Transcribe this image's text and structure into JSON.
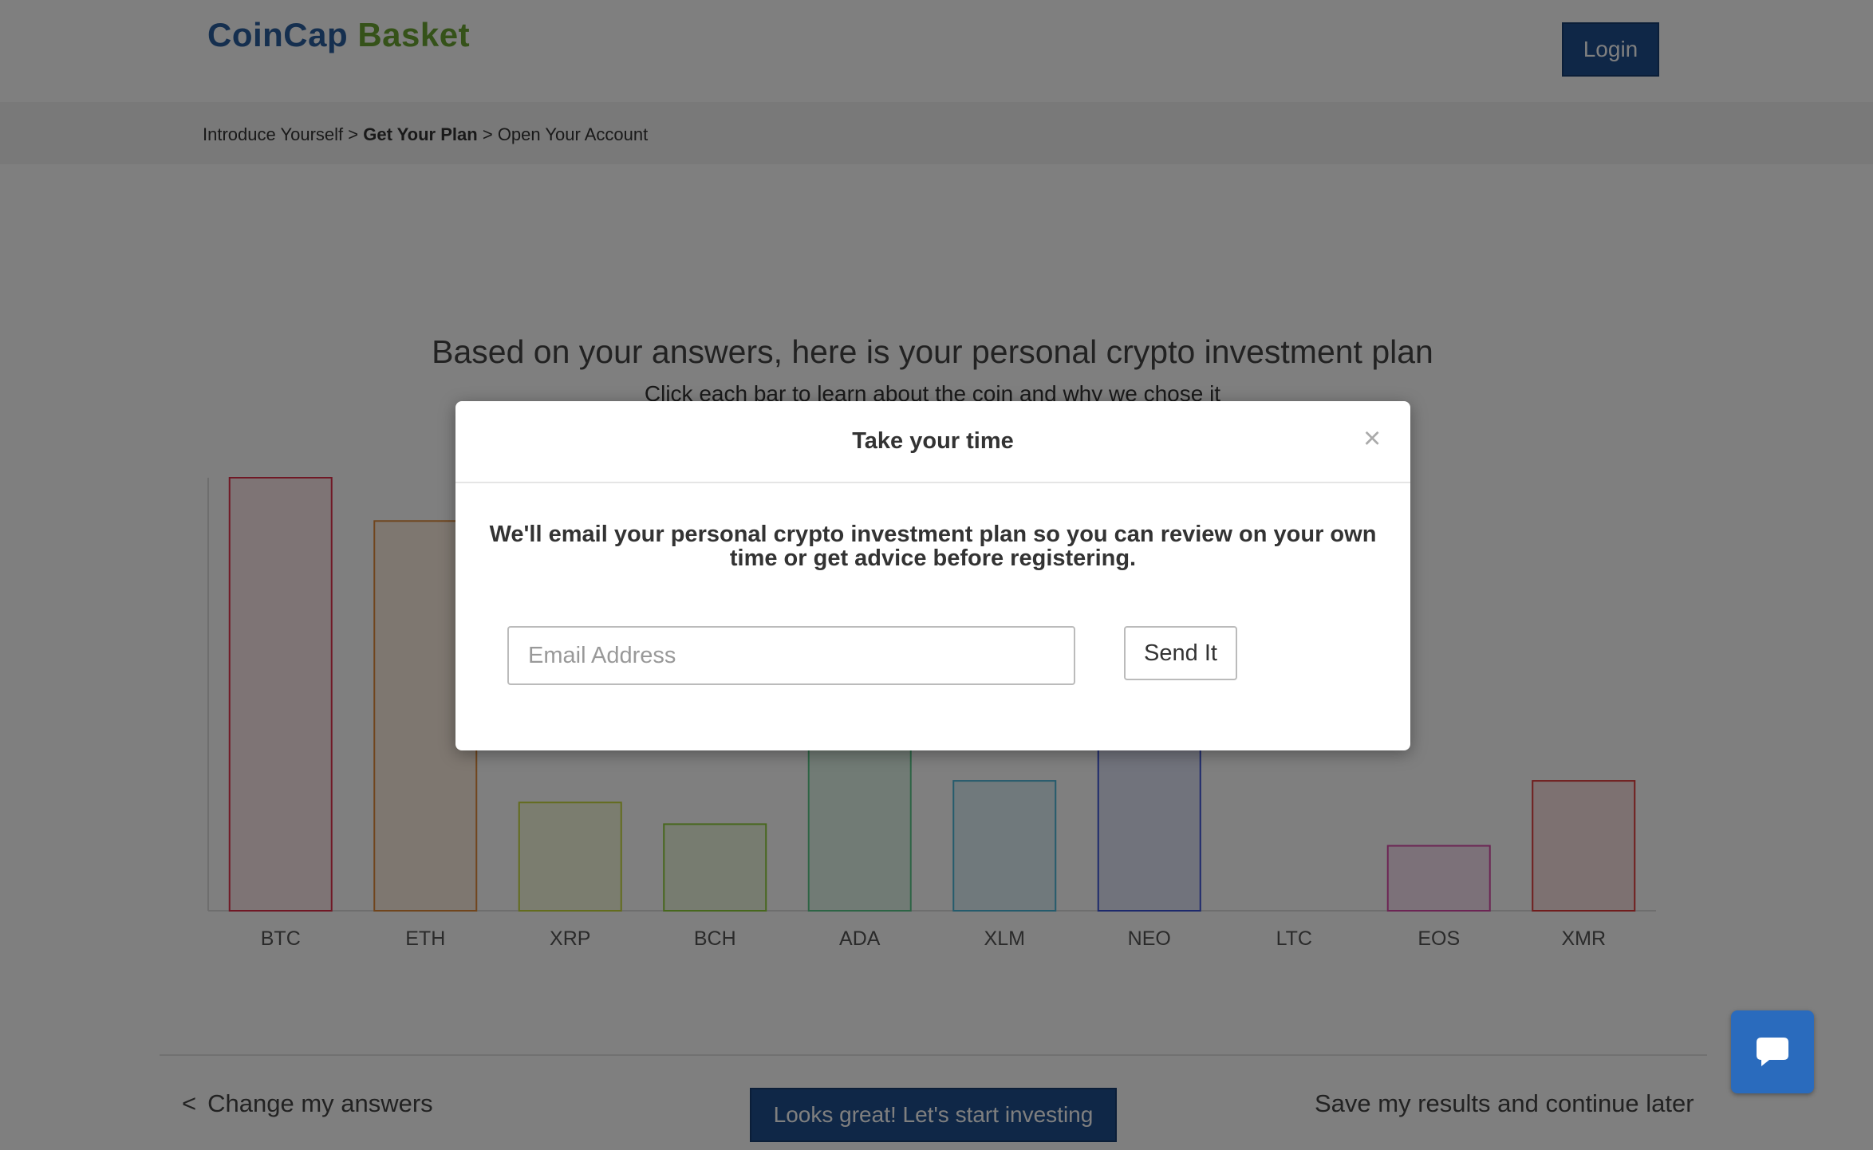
{
  "header": {
    "logo_part1": "CoinCap",
    "logo_part2": "Basket",
    "login_label": "Login"
  },
  "breadcrumb": {
    "step1": "Introduce Yourself",
    "sep": ">",
    "step2": "Get Your Plan",
    "step3": "Open Your Account"
  },
  "main": {
    "headline": "Based on your answers, here is your personal crypto investment plan",
    "subline": "Click each bar to learn about the coin and why we chose it"
  },
  "chart_data": {
    "type": "bar",
    "categories": [
      "BTC",
      "ETH",
      "XRP",
      "BCH",
      "ADA",
      "XLM",
      "NEO",
      "LTC",
      "EOS",
      "XMR"
    ],
    "values": [
      100,
      90,
      25,
      20,
      50,
      30,
      50,
      0,
      15,
      30
    ],
    "ylim": [
      0,
      100
    ],
    "colors": [
      "#e0314a",
      "#e08a3a",
      "#c7d93a",
      "#8fce3a",
      "#5ac88a",
      "#4ab6d8",
      "#3a52d8",
      "#888888",
      "#d84aa8",
      "#e03a3a"
    ],
    "fills": [
      "#fde8ea",
      "#fdeee0",
      "#f6fadf",
      "#eef8e1",
      "#e3f6ea",
      "#e1f3f9",
      "#e3e7f9",
      "#eeeeee",
      "#f9e3f2",
      "#fbe2e2"
    ],
    "grid": false,
    "legend": "none"
  },
  "footer": {
    "back_chevron": "<",
    "back_label": "Change my answers",
    "cta_label": "Looks great! Let's start investing",
    "save_label": "Save my results and continue later"
  },
  "modal": {
    "title": "Take your time",
    "close_glyph": "×",
    "message": "We'll email your personal crypto investment plan so you can review on your own time or get advice before registering.",
    "email_placeholder": "Email Address",
    "email_value": "",
    "send_label": "Send It"
  },
  "chat": {
    "icon": "chat-bubble-icon"
  }
}
